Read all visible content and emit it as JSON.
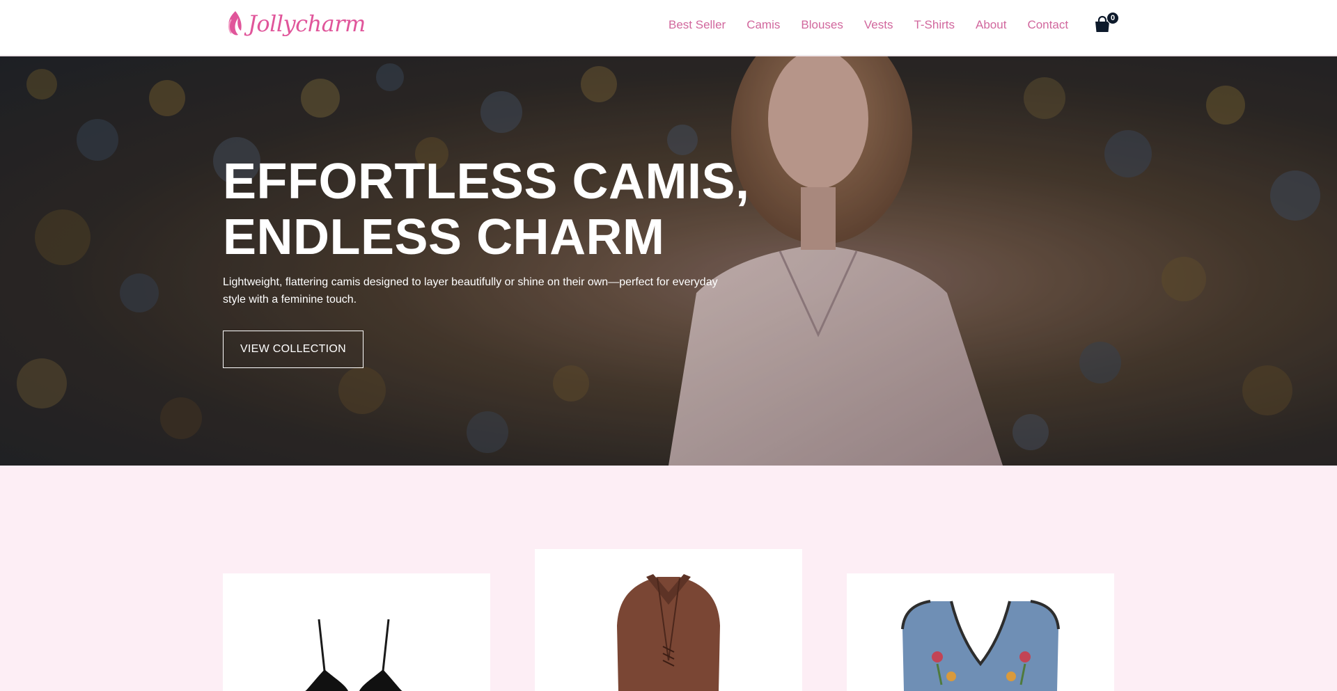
{
  "brand": {
    "name": "Jollycharm",
    "accent_color": "#e0559a",
    "nav_color": "#d1679d",
    "logo_icon": "leaf-flame-icon"
  },
  "nav": {
    "items": [
      {
        "label": "Best Seller"
      },
      {
        "label": "Camis"
      },
      {
        "label": "Blouses"
      },
      {
        "label": "Vests"
      },
      {
        "label": "T-Shirts"
      },
      {
        "label": "About"
      },
      {
        "label": "Contact"
      }
    ],
    "cart": {
      "icon": "shopping-bag-icon",
      "count": "0"
    }
  },
  "hero": {
    "title_line1": "EFFORTLESS CAMIS,",
    "title_line2": "ENDLESS CHARM",
    "subtitle": "Lightweight, flattering camis designed to layer beautifully or shine on their own—perfect for everyday style with a feminine touch.",
    "cta_label": "VIEW COLLECTION"
  },
  "section": {
    "background": "#fdeef5"
  },
  "products": [
    {
      "image": "black-cami-image"
    },
    {
      "image": "brown-blouse-image"
    },
    {
      "image": "embroidered-denim-vest-image"
    }
  ]
}
